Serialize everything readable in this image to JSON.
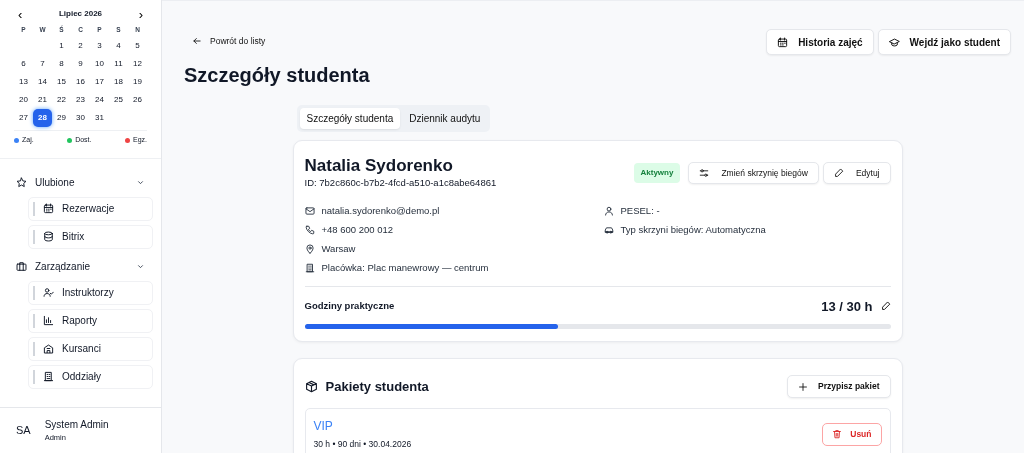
{
  "calendar": {
    "month": "Lipiec 2026",
    "prev": "‹",
    "next": "›",
    "weekdays": [
      "P",
      "W",
      "Ś",
      "C",
      "P",
      "S",
      "N"
    ],
    "weeks": [
      [
        {
          "day": "1",
          "selected": false
        },
        {
          "day": "2",
          "selected": false
        },
        {
          "day": "3",
          "selected": false
        },
        {
          "day": "4",
          "selected": false
        },
        {
          "day": "5",
          "selected": false
        }
      ],
      [
        {
          "day": "6",
          "selected": false
        },
        {
          "day": "7",
          "selected": false
        },
        {
          "day": "8",
          "selected": false
        },
        {
          "day": "9",
          "selected": false
        },
        {
          "day": "10",
          "selected": false
        },
        {
          "day": "11",
          "selected": false
        },
        {
          "day": "12",
          "selected": false
        }
      ],
      [
        {
          "day": "13",
          "selected": false
        },
        {
          "day": "14",
          "selected": false
        },
        {
          "day": "15",
          "selected": false
        },
        {
          "day": "16",
          "selected": false
        },
        {
          "day": "17",
          "selected": false
        },
        {
          "day": "18",
          "selected": false
        },
        {
          "day": "19",
          "selected": false
        }
      ],
      [
        {
          "day": "20",
          "selected": false
        },
        {
          "day": "21",
          "selected": false
        },
        {
          "day": "22",
          "selected": false
        },
        {
          "day": "23",
          "selected": false
        },
        {
          "day": "24",
          "selected": false
        },
        {
          "day": "25",
          "selected": false
        },
        {
          "day": "26",
          "selected": false
        }
      ],
      [
        {
          "day": "27",
          "selected": false
        },
        {
          "day": "28",
          "selected": true
        },
        {
          "day": "29",
          "selected": false
        },
        {
          "day": "30",
          "selected": false
        },
        {
          "day": "31",
          "selected": false
        }
      ]
    ],
    "legend": [
      {
        "label": "Zaj.",
        "color": "#3b82f6"
      },
      {
        "label": "Dost.",
        "color": "#22c55e"
      },
      {
        "label": "Egz.",
        "color": "#ef4444"
      }
    ]
  },
  "sidebar": {
    "groups": [
      {
        "label": "Ulubione",
        "expanded": true,
        "items": [
          "Rezerwacje",
          "Bitrix"
        ]
      },
      {
        "label": "Zarządzanie",
        "expanded": true,
        "items": [
          "Instruktorzy",
          "Raporty",
          "Kursanci",
          "Oddziały"
        ]
      }
    ],
    "user": {
      "initials": "SA",
      "name": "System Admin",
      "role": "Admin"
    }
  },
  "header": {
    "back": "Powrót do listy",
    "title": "Szczegóły studenta",
    "buttons": [
      "Historia zajęć",
      "Wejdź jako student"
    ]
  },
  "tabs": [
    {
      "label": "Szczegóły studenta",
      "selected": true
    },
    {
      "label": "Dziennik audytu",
      "selected": false
    }
  ],
  "student": {
    "name": "Natalia Sydorenko",
    "id": "ID: 7b2c860c-b7b2-4fcd-a510-a1c8abe64861",
    "status": "Aktywny",
    "actions": [
      "Zmień skrzynię biegów",
      "Edytuj"
    ],
    "details_left": [
      "natalia.sydorenko@demo.pl",
      "+48 600 200 012",
      "Warsaw",
      "Placówka: Plac manewrowy — centrum"
    ],
    "details_right": [
      "PESEL: -",
      "Typ skrzyni biegów: Automatyczna"
    ],
    "hours": {
      "label": "Godziny praktyczne",
      "reading": "13 / 30 h",
      "level": 0.433
    }
  },
  "packages": {
    "title": "Pakiety studenta",
    "add": "Przypisz pakiet",
    "items": [
      {
        "name": "VIP",
        "meta": "30 h • 90 dni • 30.04.2026",
        "remove": "Usuń"
      }
    ]
  }
}
